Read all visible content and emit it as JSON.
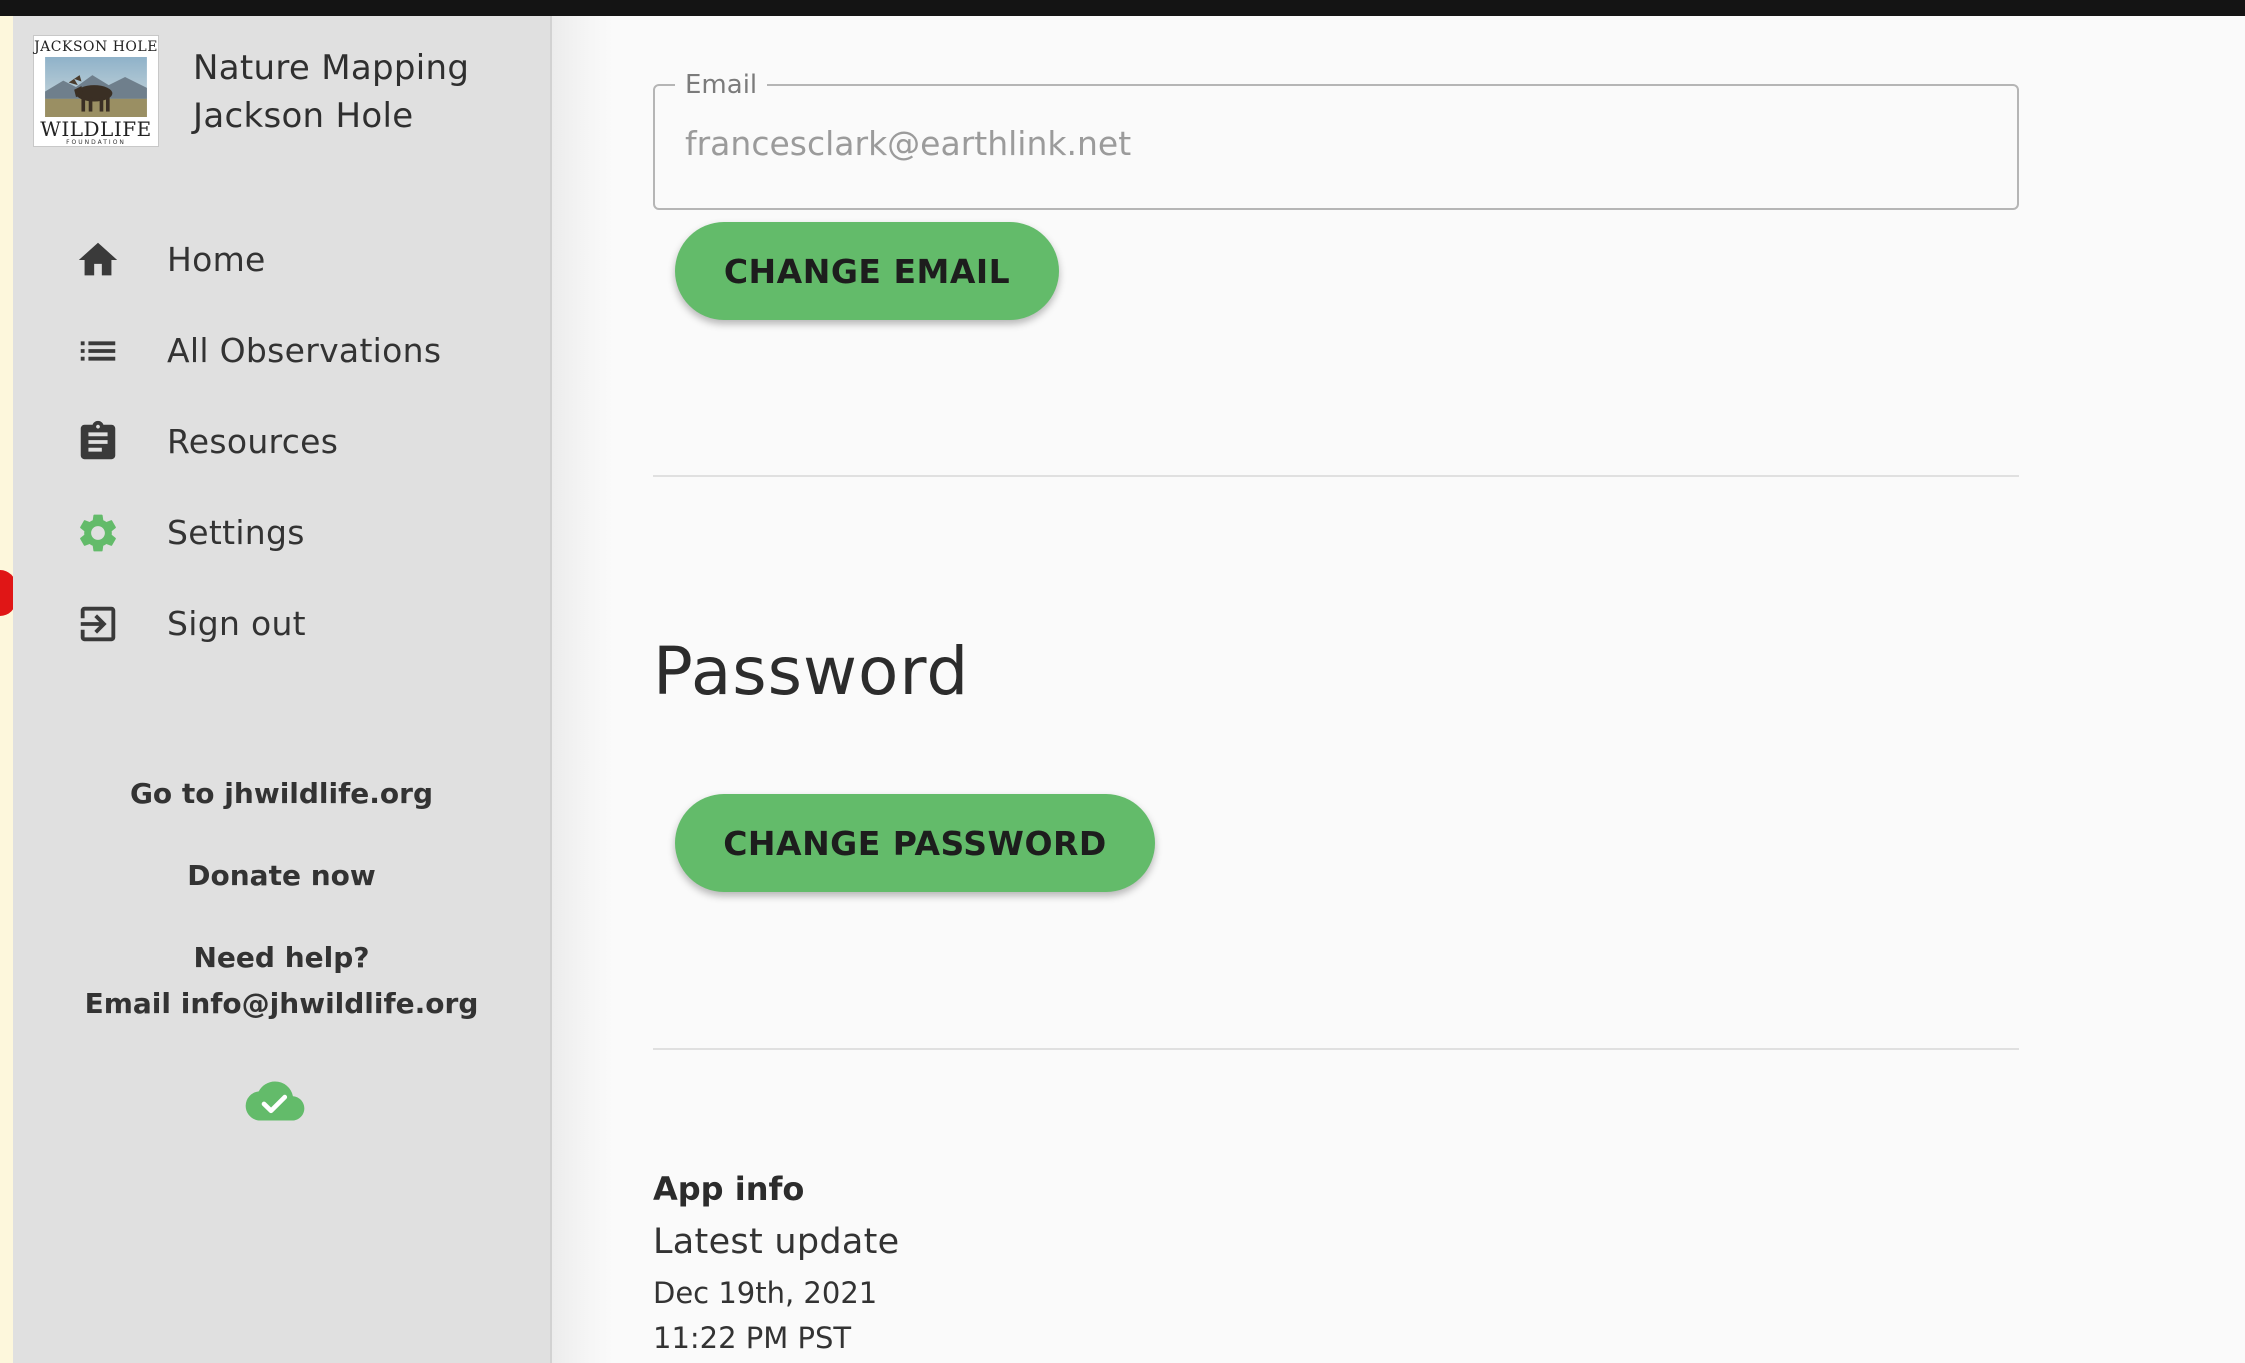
{
  "app": {
    "title_line1": "Nature Mapping",
    "title_line2": "Jackson Hole",
    "logo_top": "JACKSON HOLE",
    "logo_bottom": "WILDLIFE",
    "logo_tiny": "FOUNDATION"
  },
  "sidebar": {
    "items": [
      {
        "label": "Home",
        "icon": "home-icon"
      },
      {
        "label": "All Observations",
        "icon": "list-icon"
      },
      {
        "label": "Resources",
        "icon": "clipboard-icon"
      },
      {
        "label": "Settings",
        "icon": "gear-icon",
        "active": true
      },
      {
        "label": "Sign out",
        "icon": "sign-out-icon"
      }
    ],
    "links": {
      "website": "Go to jhwildlife.org",
      "donate": "Donate now",
      "help_line1": "Need help?",
      "help_line2": "Email info@jhwildlife.org"
    },
    "sync_status_icon": "cloud-check-icon"
  },
  "main": {
    "email": {
      "legend": "Email",
      "value": "francesclark@earthlink.net",
      "button_label": "CHANGE EMAIL"
    },
    "password": {
      "heading": "Password",
      "button_label": "CHANGE PASSWORD"
    },
    "app_info": {
      "title": "App info",
      "subtitle": "Latest update",
      "date": "Dec 19th, 2021",
      "time": "11:22 PM PST"
    }
  },
  "colors": {
    "accent_green": "#63bb6a",
    "sidebar_bg": "#e0e0e0",
    "content_bg": "#fafafa",
    "text_dark": "#333333"
  }
}
